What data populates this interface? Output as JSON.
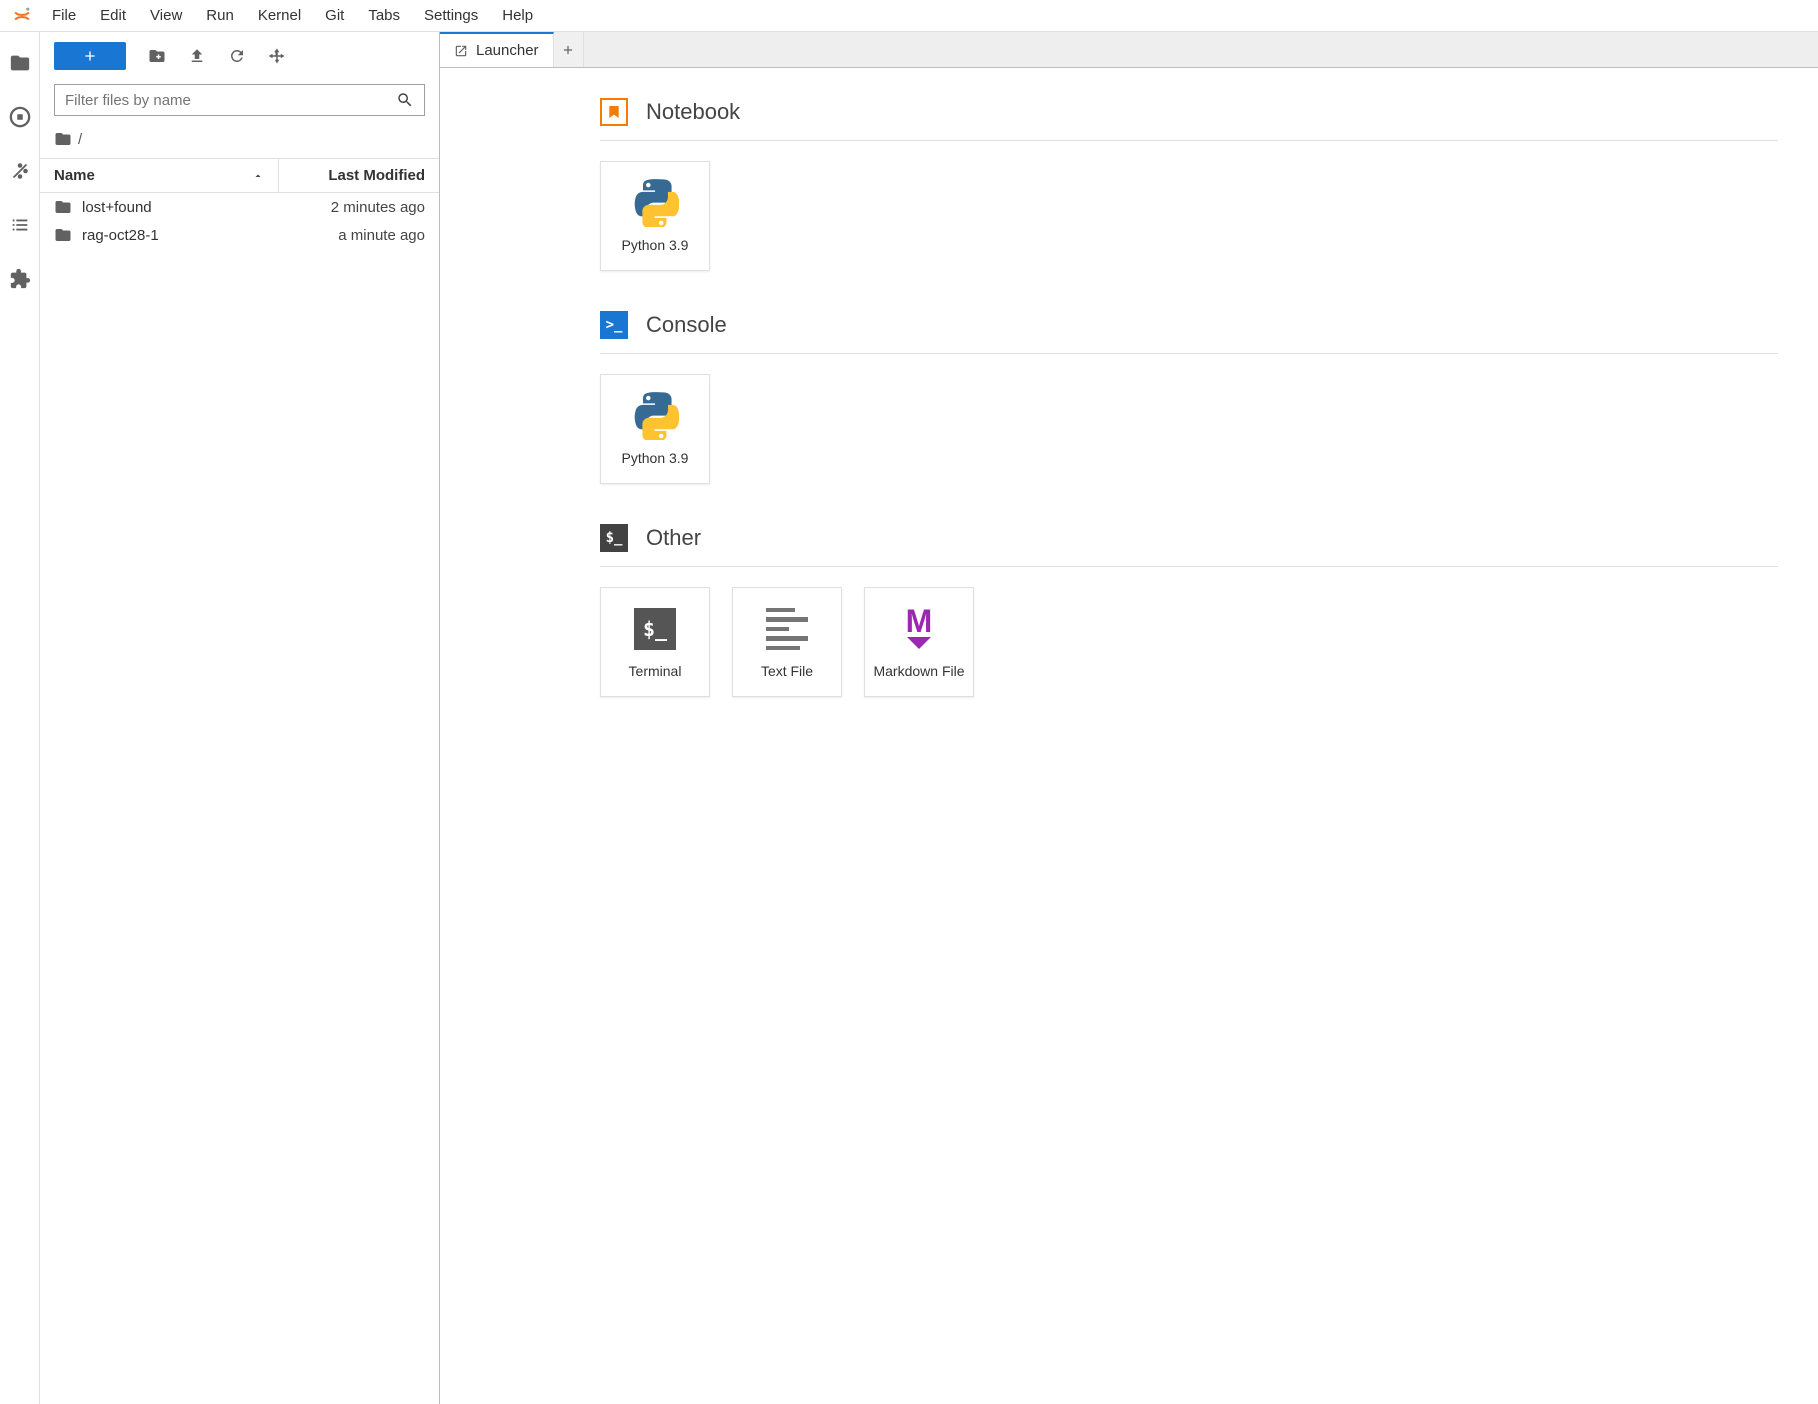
{
  "menu": {
    "items": [
      "File",
      "Edit",
      "View",
      "Run",
      "Kernel",
      "Git",
      "Tabs",
      "Settings",
      "Help"
    ]
  },
  "filebrowser": {
    "filter_placeholder": "Filter files by name",
    "breadcrumb": "/",
    "columns": {
      "name": "Name",
      "modified": "Last Modified"
    },
    "files": [
      {
        "name": "lost+found",
        "modified": "2 minutes ago"
      },
      {
        "name": "rag-oct28-1",
        "modified": "a minute ago"
      }
    ]
  },
  "tab": {
    "title": "Launcher"
  },
  "launcher": {
    "sections": {
      "notebook": {
        "title": "Notebook",
        "cards": [
          {
            "label": "Python 3.9"
          }
        ]
      },
      "console": {
        "title": "Console",
        "cards": [
          {
            "label": "Python 3.9"
          }
        ]
      },
      "other": {
        "title": "Other",
        "cards": [
          {
            "label": "Terminal"
          },
          {
            "label": "Text File"
          },
          {
            "label": "Markdown File"
          }
        ]
      }
    }
  }
}
